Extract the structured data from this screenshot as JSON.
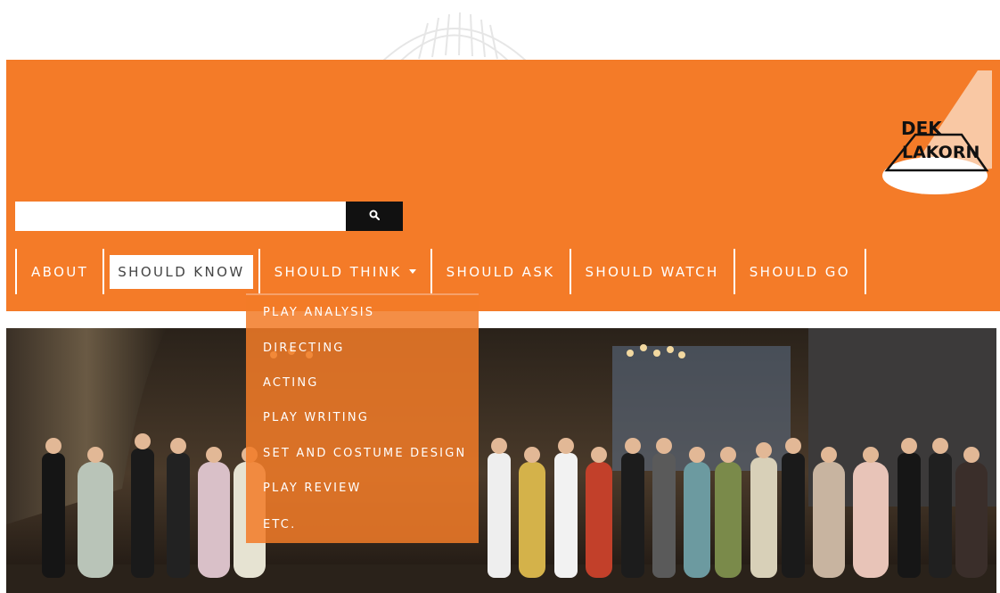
{
  "search": {
    "placeholder": "",
    "value": ""
  },
  "nav": {
    "items": [
      {
        "label": "ABOUT"
      },
      {
        "label": "SHOULD KNOW"
      },
      {
        "label": "SHOULD THINK"
      },
      {
        "label": "SHOULD ASK"
      },
      {
        "label": "SHOULD WATCH"
      },
      {
        "label": "SHOULD GO"
      }
    ]
  },
  "dropdown": {
    "items": [
      {
        "label": "PLAY ANALYSIS"
      },
      {
        "label": "DIRECTING"
      },
      {
        "label": "ACTING"
      },
      {
        "label": "PLAY WRITING"
      },
      {
        "label": "SET AND COSTUME DESIGN"
      },
      {
        "label": "PLAY REVIEW"
      },
      {
        "label": "ETC."
      }
    ]
  },
  "logo": {
    "line1": "DEK",
    "line2": "LAKORN"
  },
  "colors": {
    "brand": "#f47b28",
    "dropdown_bg": "#f27b28",
    "search_button": "#111111"
  },
  "icons": {
    "search": "search-icon",
    "caret": "chevron-down-icon"
  }
}
